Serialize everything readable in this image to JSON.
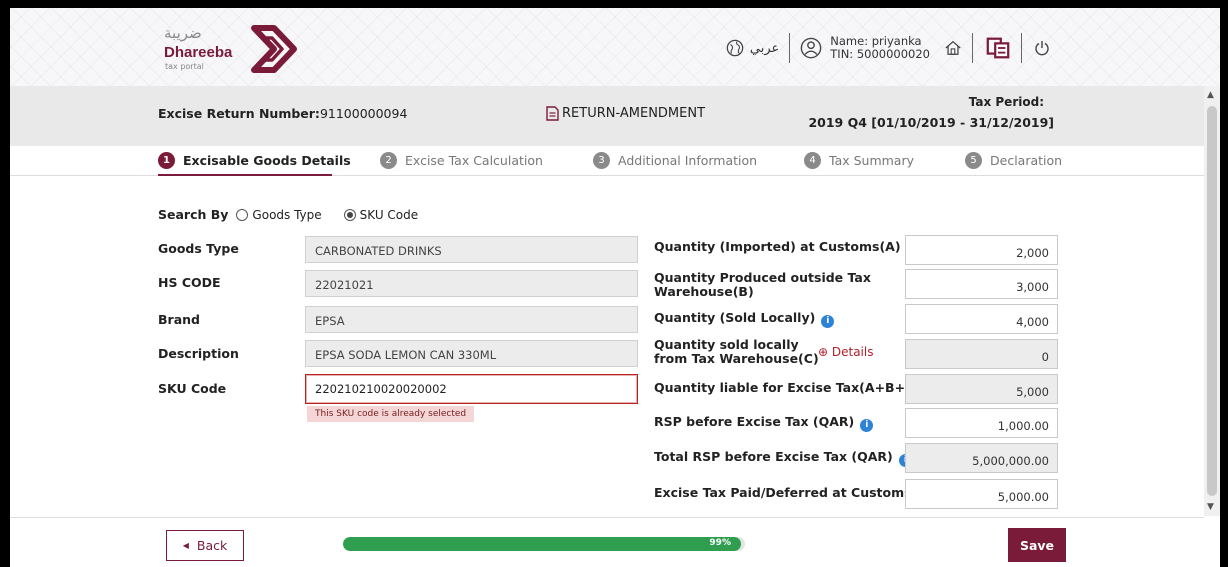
{
  "header": {
    "logo_arabic": "ضريبة",
    "logo_name": "Dhareeba",
    "logo_sub": "tax portal",
    "language_label": "عربي",
    "user_name": "Name: priyanka",
    "user_tin": "TIN: 5000000020"
  },
  "infobar": {
    "return_number_label": "Excise Return Number:",
    "return_number_value": "91100000094",
    "mode": "RETURN-AMENDMENT",
    "tax_period_label": "Tax Period:",
    "tax_period_value": "2019 Q4 [01/10/2019 - 31/12/2019]"
  },
  "steps": [
    {
      "num": "1",
      "label": "Excisable Goods Details",
      "active": true
    },
    {
      "num": "2",
      "label": "Excise Tax Calculation",
      "active": false
    },
    {
      "num": "3",
      "label": "Additional Information",
      "active": false
    },
    {
      "num": "4",
      "label": "Tax Summary",
      "active": false
    },
    {
      "num": "5",
      "label": "Declaration",
      "active": false
    }
  ],
  "search": {
    "label": "Search By",
    "option_goods_type": "Goods Type",
    "option_sku_code": "SKU Code",
    "selected": "SKU Code"
  },
  "left_fields": {
    "goods_type_label": "Goods Type",
    "goods_type_value": "CARBONATED DRINKS",
    "hs_code_label": "HS CODE",
    "hs_code_value": "22021021",
    "brand_label": "Brand",
    "brand_value": "EPSA",
    "description_label": "Description",
    "description_value": "EPSA SODA LEMON CAN 330ML",
    "sku_label": "SKU Code",
    "sku_value": "220210210020020002",
    "sku_error": "This SKU code is already selected"
  },
  "right_fields": {
    "qty_imported_label": "Quantity (Imported) at Customs(A)",
    "qty_imported_value": "2,000",
    "qty_produced_label_1": "Quantity Produced outside Tax",
    "qty_produced_label_2": "Warehouse(B)",
    "qty_produced_value": "3,000",
    "qty_sold_label": "Quantity (Sold Locally)",
    "qty_sold_value": "4,000",
    "qty_sold_wh_label_1": "Quantity sold locally",
    "qty_sold_wh_label_2": "from Tax Warehouse(C)",
    "details_link": "⊕ Details",
    "qty_sold_wh_value": "0",
    "qty_liable_label": "Quantity liable for Excise Tax(A+B+C)",
    "qty_liable_value": "5,000",
    "rsp_label": "RSP before Excise Tax (QAR)",
    "rsp_value": "1,000.00",
    "total_rsp_label": "Total RSP before Excise Tax (QAR)",
    "total_rsp_value": "5,000,000.00",
    "tax_paid_label": "Excise Tax Paid/Deferred at Customs",
    "tax_paid_value": "5,000.00"
  },
  "info_icon_glyph": "i",
  "footer": {
    "back_label": "Back",
    "progress_percent": 99,
    "progress_text": "99%",
    "save_label": "Save"
  },
  "colors": {
    "brand": "#7a1b3a",
    "progress": "#2f9e4f",
    "info_icon": "#2f83d6",
    "error_bg": "#f4d6d6"
  }
}
